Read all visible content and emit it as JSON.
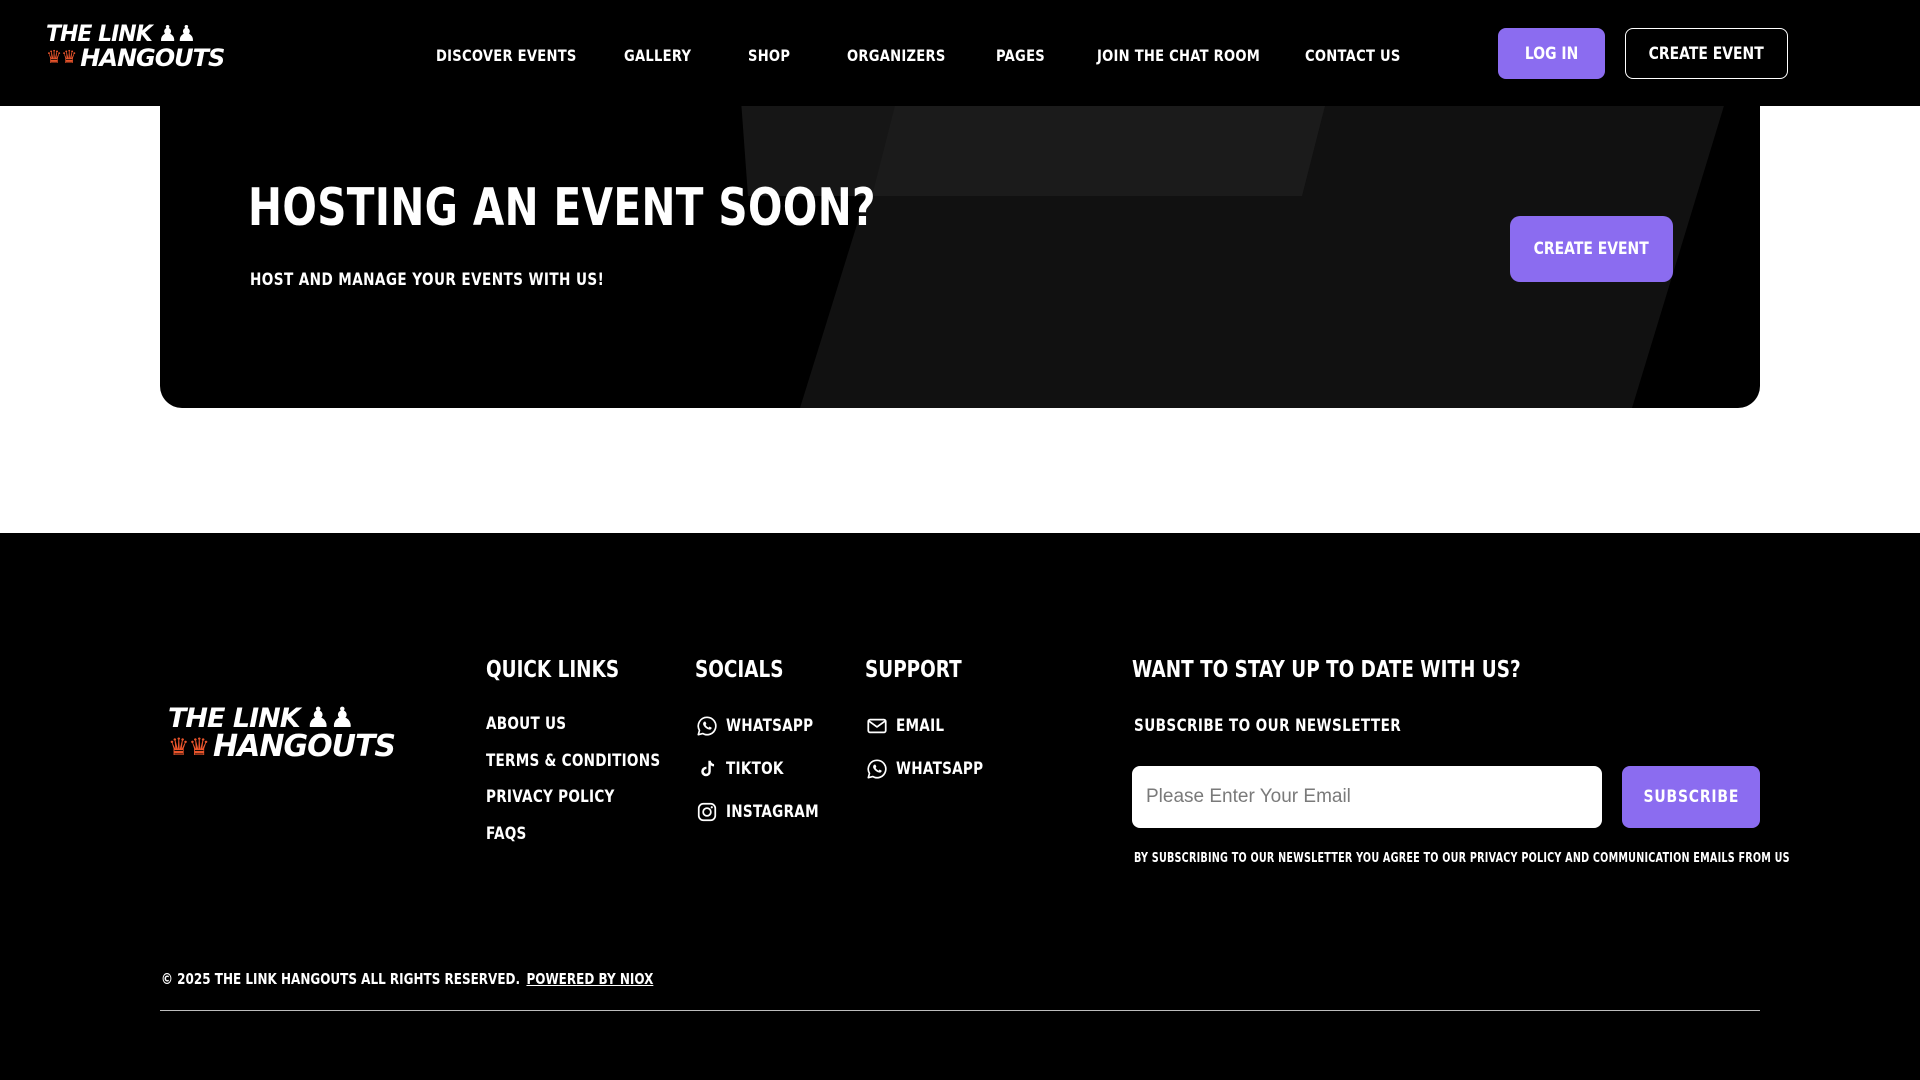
{
  "brand": {
    "line1": "THE LINK",
    "line2": "HANGOUTS",
    "chess_glyphs": "♟♟",
    "crown_glyphs": "♛♛"
  },
  "nav": {
    "items": [
      {
        "label": "DISCOVER EVENTS"
      },
      {
        "label": "GALLERY"
      },
      {
        "label": "SHOP"
      },
      {
        "label": "ORGANIZERS"
      },
      {
        "label": "PAGES"
      },
      {
        "label": "JOIN THE CHAT ROOM"
      },
      {
        "label": "CONTACT US"
      }
    ],
    "login_label": "LOG IN",
    "create_event_label": "CREATE EVENT"
  },
  "hero": {
    "title": "HOSTING AN EVENT SOON?",
    "subtitle": "HOST AND MANAGE YOUR EVENTS WITH US!",
    "cta_label": "CREATE EVENT"
  },
  "footer": {
    "quick_links": {
      "heading": "QUICK LINKS",
      "items": [
        {
          "label": "ABOUT US"
        },
        {
          "label": "TERMS & CONDITIONS"
        },
        {
          "label": "PRIVACY POLICY"
        },
        {
          "label": "FAQS"
        }
      ]
    },
    "socials": {
      "heading": "SOCIALS",
      "items": [
        {
          "label": "WHATSAPP",
          "icon": "whatsapp-icon"
        },
        {
          "label": "TIKTOK",
          "icon": "tiktok-icon"
        },
        {
          "label": "INSTAGRAM",
          "icon": "instagram-icon"
        }
      ]
    },
    "support": {
      "heading": "SUPPORT",
      "items": [
        {
          "label": "EMAIL",
          "icon": "mail-icon"
        },
        {
          "label": "WHATSAPP",
          "icon": "whatsapp-icon"
        }
      ]
    },
    "newsletter": {
      "heading": "WANT TO STAY UP TO DATE WITH US?",
      "subheading": "SUBSCRIBE TO OUR NEWSLETTER",
      "email_placeholder": "Please Enter Your Email",
      "email_value": "",
      "subscribe_label": "SUBSCRIBE",
      "disclaimer": "BY SUBSCRIBING TO OUR NEWSLETTER YOU AGREE TO OUR PRIVACY POLICY AND COMMUNICATION EMAILS FROM US"
    },
    "copyright": "© 2025 THE LINK HANGOUTS ALL RIGHTS RESERVED.",
    "powered_by": "POWERED BY NIOX"
  },
  "colors": {
    "accent": "#8b6cf0",
    "background_dark": "#000000",
    "background_light": "#ffffff",
    "logo_crown": "#e8542b"
  }
}
